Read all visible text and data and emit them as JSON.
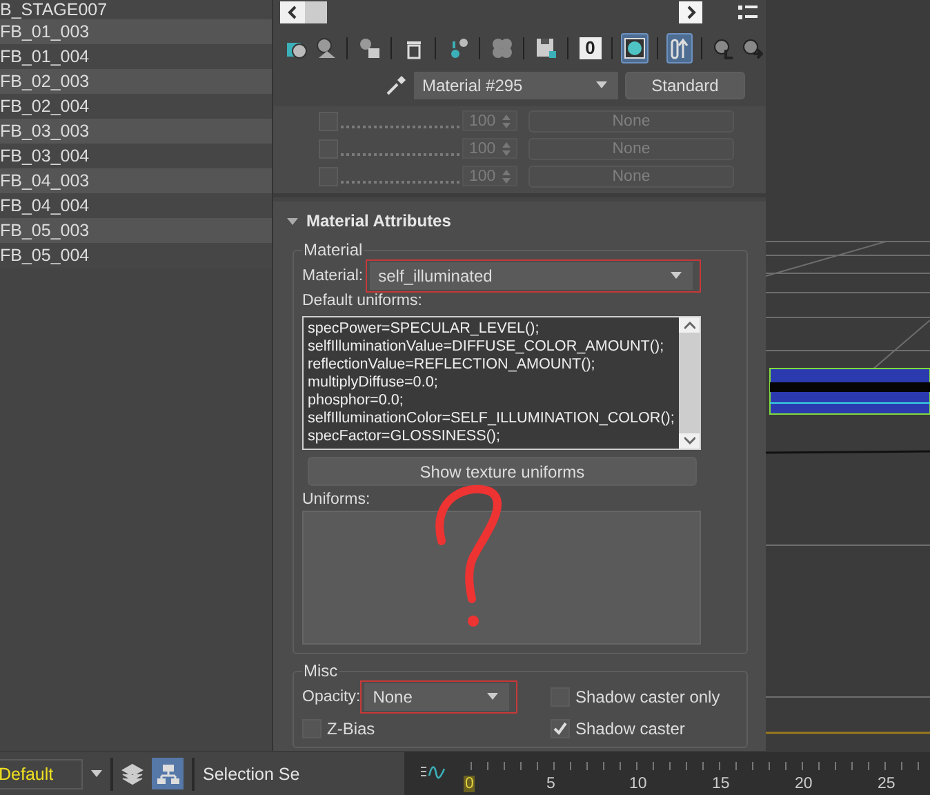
{
  "scene_list": {
    "rows": [
      "B_STAGE007",
      "FB_01_003",
      "FB_01_004",
      "FB_02_003",
      "FB_02_004",
      "FB_03_003",
      "FB_03_004",
      "FB_04_003",
      "FB_04_004",
      "FB_05_003",
      "FB_05_004"
    ]
  },
  "panel": {
    "toolbar": [
      {
        "kind": "get",
        "active": false
      },
      {
        "kind": "put",
        "active": false
      },
      {
        "kind": "assign",
        "active": false
      },
      {
        "kind": "delete",
        "active": false
      },
      {
        "kind": "copy",
        "active": false
      },
      {
        "kind": "checker",
        "active": false
      },
      {
        "kind": "save",
        "active": false
      },
      {
        "kind": "channel",
        "active": false
      },
      {
        "kind": "background",
        "active": true
      },
      {
        "kind": "viewport",
        "active": true
      },
      {
        "kind": "parent",
        "active": false
      },
      {
        "kind": "sibling",
        "active": false
      }
    ],
    "channel_label": "0",
    "material_name": "Material #295",
    "type_button": "Standard",
    "map_rows": [
      {
        "checked": false,
        "amount": "100",
        "map": "None"
      },
      {
        "checked": false,
        "amount": "100",
        "map": "None"
      },
      {
        "checked": false,
        "amount": "100",
        "map": "None"
      }
    ],
    "rollout": {
      "title": "Material Attributes",
      "expanded": true
    },
    "material_group": {
      "title": "Material",
      "material_label": "Material:",
      "material_value": "self_illuminated",
      "uniforms_label": "Default uniforms:",
      "uniform_lines": [
        "specPower=SPECULAR_LEVEL();",
        "selfIlluminationValue=DIFFUSE_COLOR_AMOUNT();",
        "reflectionValue=REFLECTION_AMOUNT();",
        "multiplyDiffuse=0.0;",
        "phosphor=0.0;",
        "selfIlluminationColor=SELF_ILLUMINATION_COLOR();",
        "specFactor=GLOSSINESS();"
      ],
      "texture_button": "Show texture uniforms",
      "uniforms_list_label": "Uniforms:"
    },
    "misc_group": {
      "title": "Misc",
      "opacity_label": "Opacity:",
      "opacity_value": "None",
      "checkboxes": [
        {
          "label": "Shadow caster only",
          "checked": false
        },
        {
          "label": "Z-Bias",
          "checked": false
        },
        {
          "label": "Shadow caster",
          "checked": true
        }
      ]
    }
  },
  "bottom_bar": {
    "layer": "Default",
    "hierarchy_active": true,
    "selection_label": "Selection Se",
    "timeline_labels": [
      "0",
      "5",
      "10",
      "15",
      "20",
      "25"
    ]
  }
}
